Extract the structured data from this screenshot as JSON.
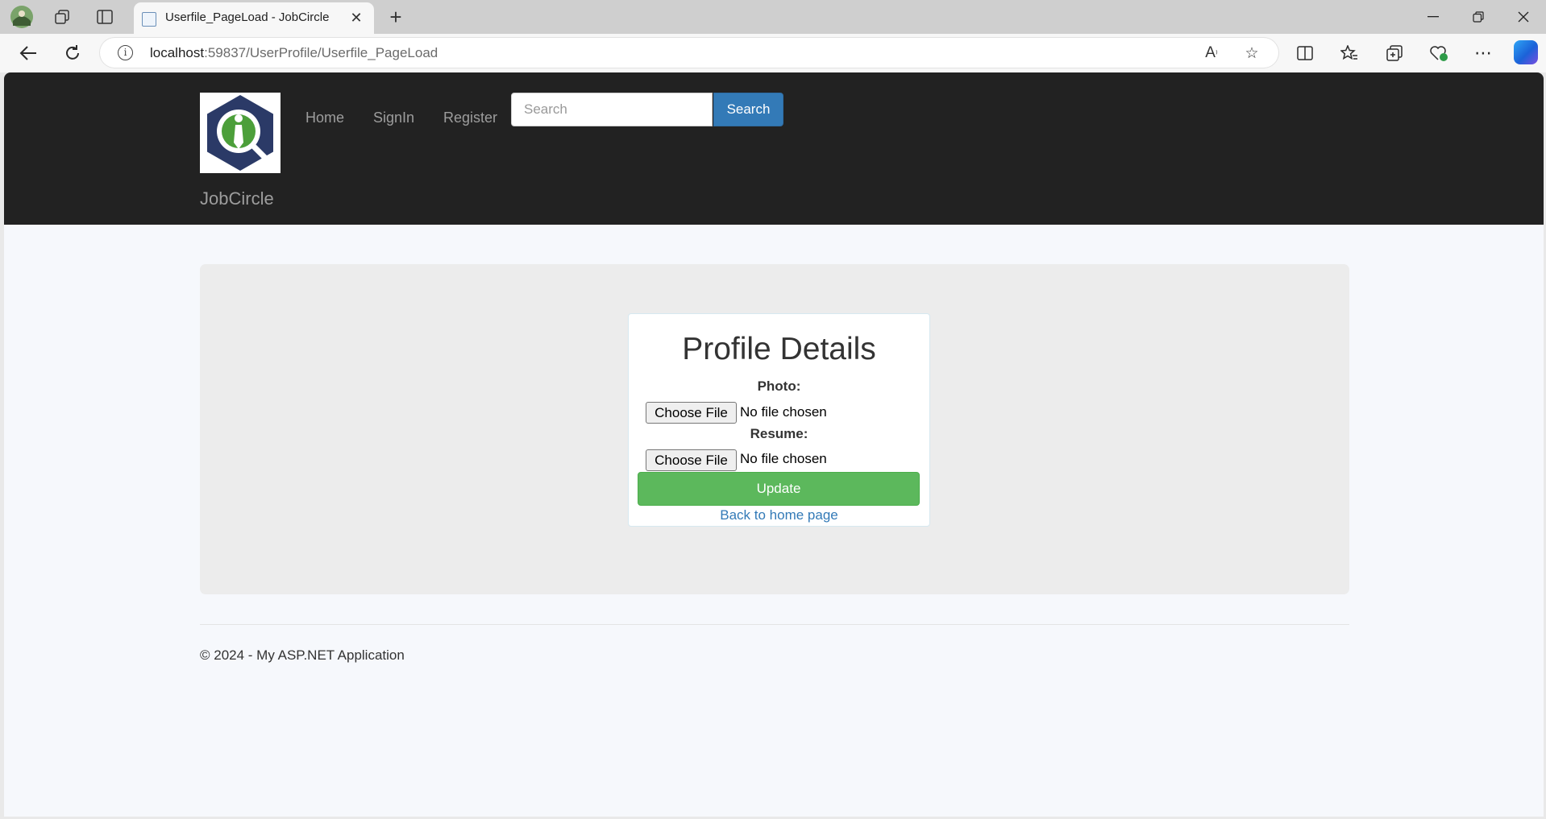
{
  "browser": {
    "tab_title": "Userfile_PageLoad - JobCircle",
    "url_host": "localhost",
    "url_rest": ":59837/UserProfile/Userfile_PageLoad"
  },
  "site": {
    "brand": "JobCircle",
    "nav": [
      "Home",
      "SignIn",
      "Register"
    ],
    "search_placeholder": "Search",
    "search_button": "Search"
  },
  "profile": {
    "title": "Profile Details",
    "photo_label": "Photo:",
    "resume_label": "Resume:",
    "choose_file": "Choose File",
    "no_file": "No file chosen",
    "update_button": "Update",
    "back_link": "Back to home page"
  },
  "footer": {
    "text": "© 2024 - My ASP.NET Application"
  },
  "colors": {
    "header_bg": "#222222",
    "primary": "#337ab7",
    "success": "#5cb85c",
    "logo_navy": "#2b3a67",
    "logo_green": "#4c9f3a"
  }
}
